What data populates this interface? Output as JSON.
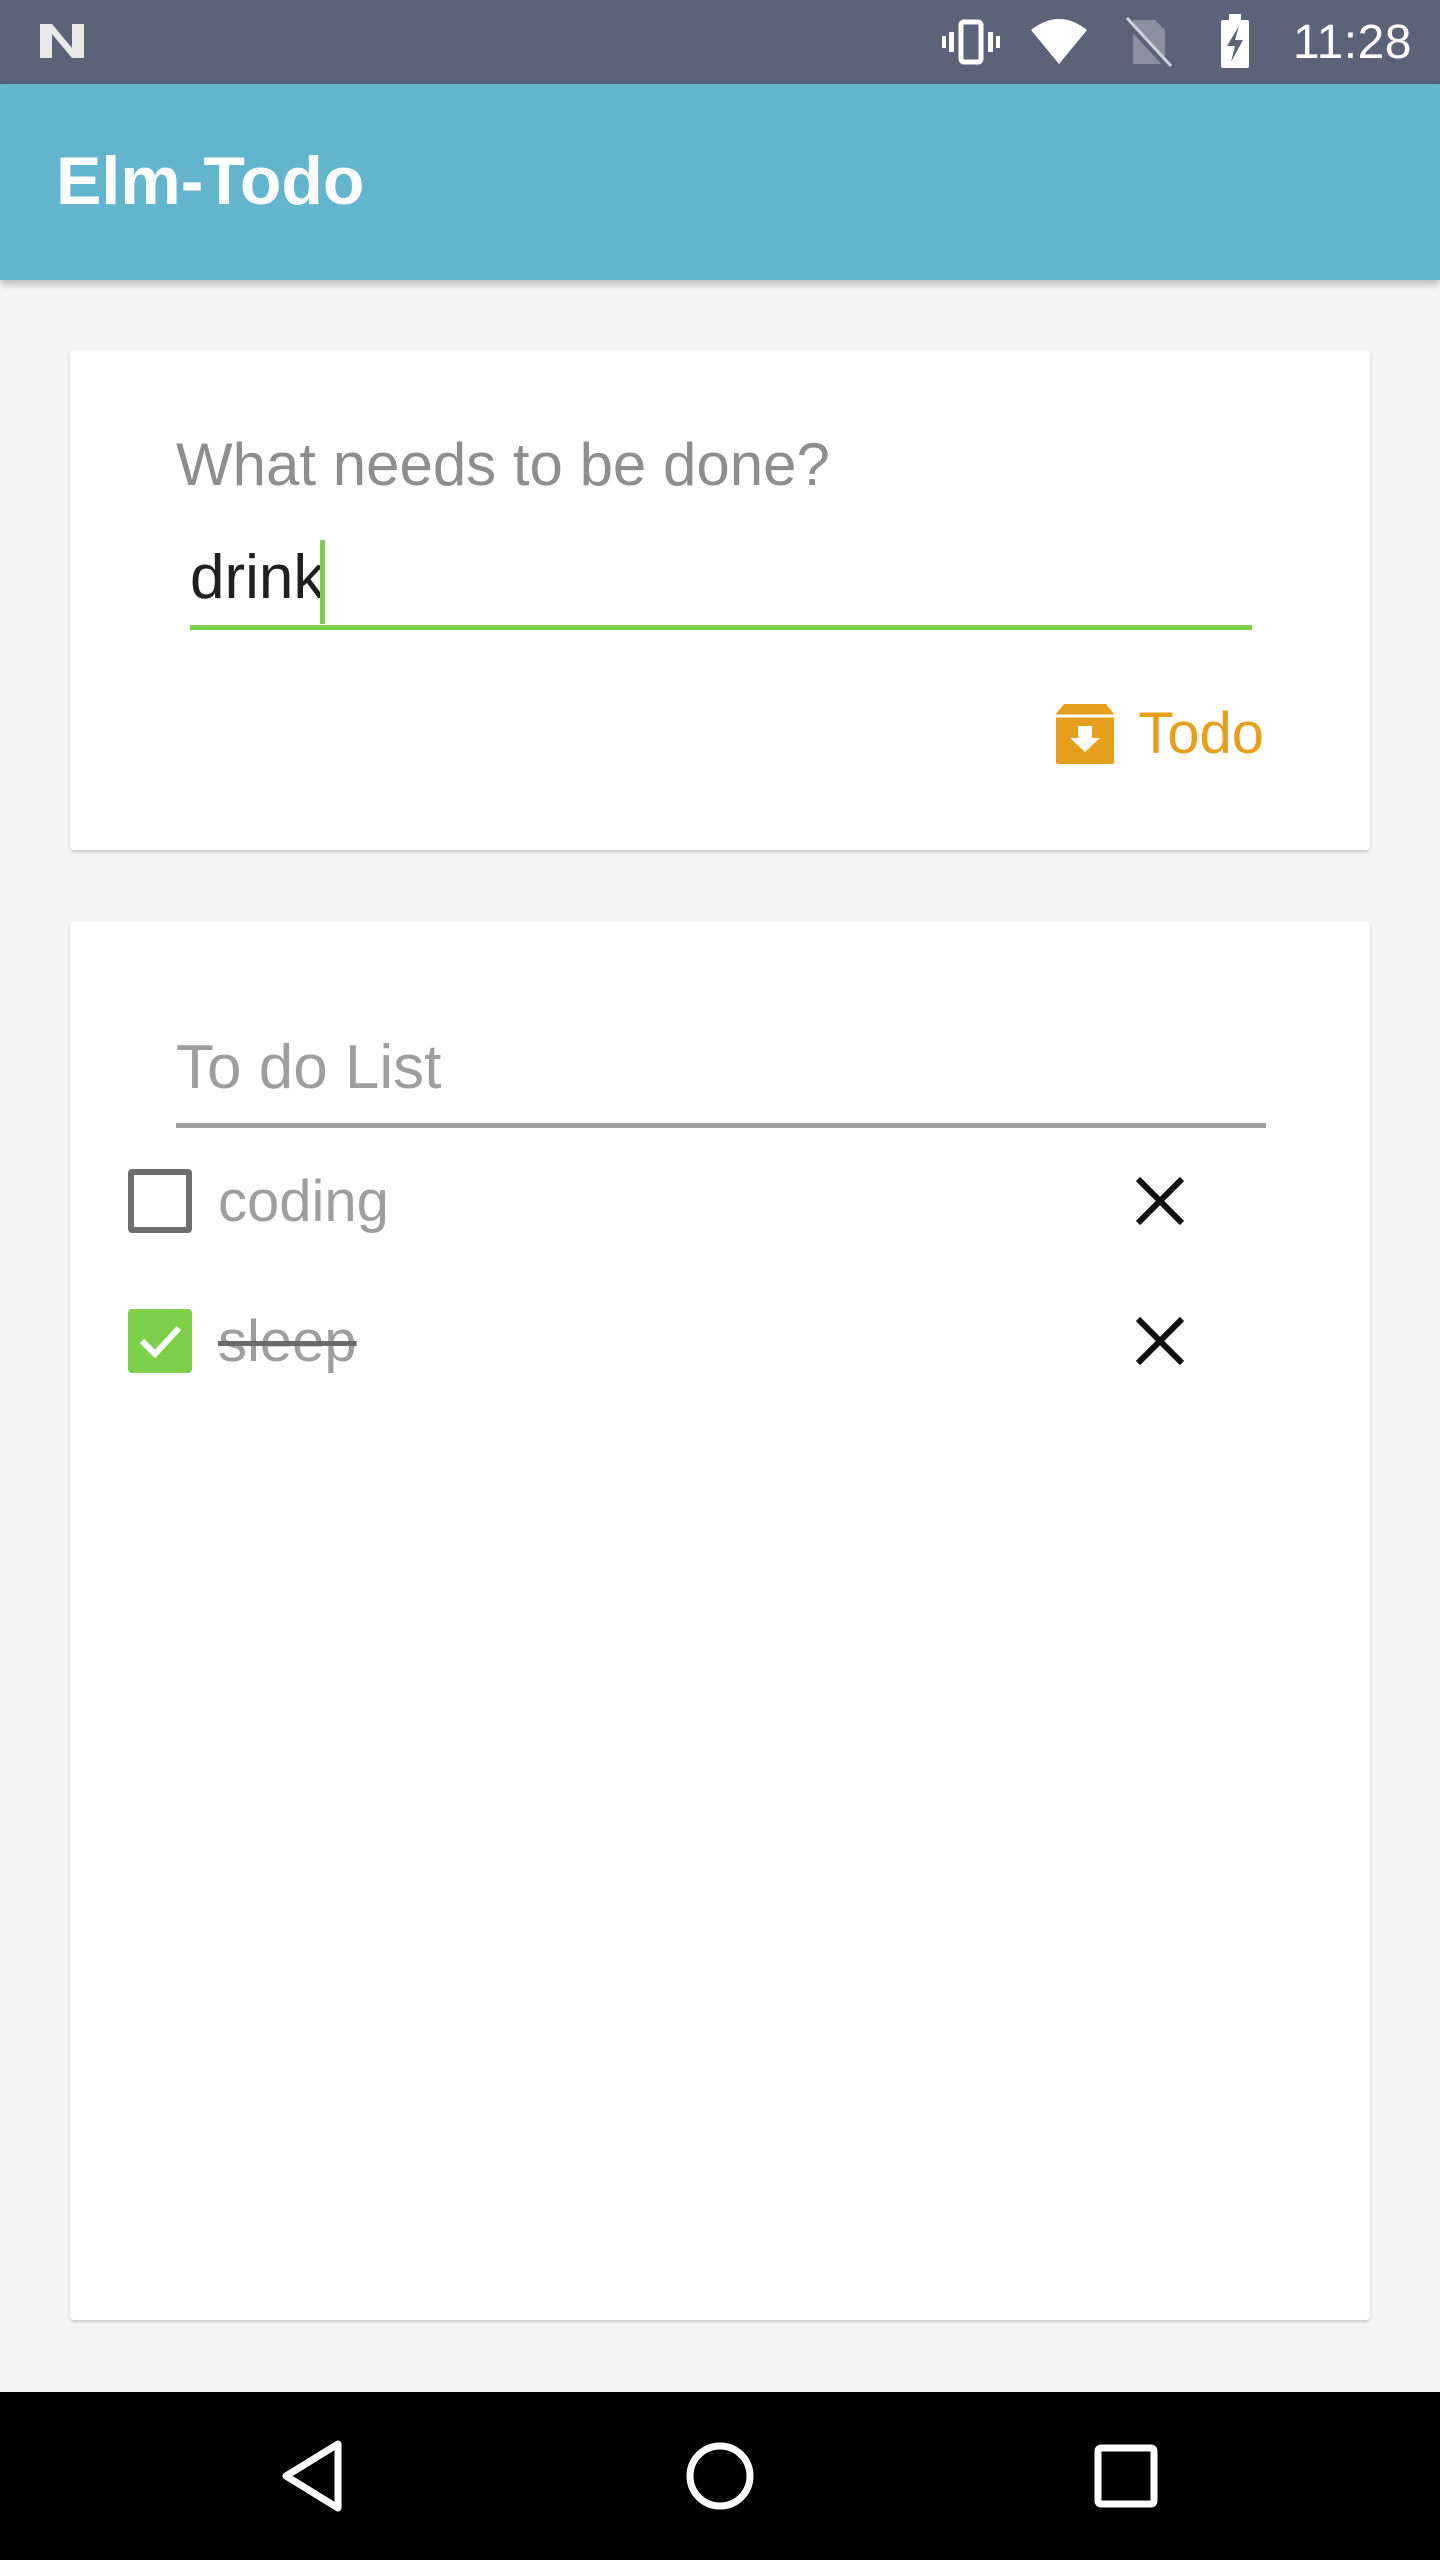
{
  "status_bar": {
    "time": "11:28",
    "icons": [
      "notification-n-icon",
      "vibrate-icon",
      "wifi-icon",
      "no-sim-icon",
      "battery-charging-icon"
    ]
  },
  "app": {
    "title": "Elm-Todo"
  },
  "new_todo": {
    "label": "What needs to be done?",
    "value": "drink",
    "button_label": "Todo",
    "button_icon": "archive-down-icon",
    "accent_color": "#e59f1d",
    "focus_color": "#7ed04a"
  },
  "todo_list": {
    "title": "To do List",
    "items": [
      {
        "text": "coding",
        "done": false
      },
      {
        "text": "sleep",
        "done": true
      }
    ],
    "delete_icon": "close-icon"
  },
  "nav_bar": {
    "icons": [
      "back-icon",
      "home-icon",
      "recents-icon"
    ]
  },
  "colors": {
    "status_bar": "#5b6378",
    "app_bar": "#62b5cc",
    "check_green": "#7ed04a"
  }
}
